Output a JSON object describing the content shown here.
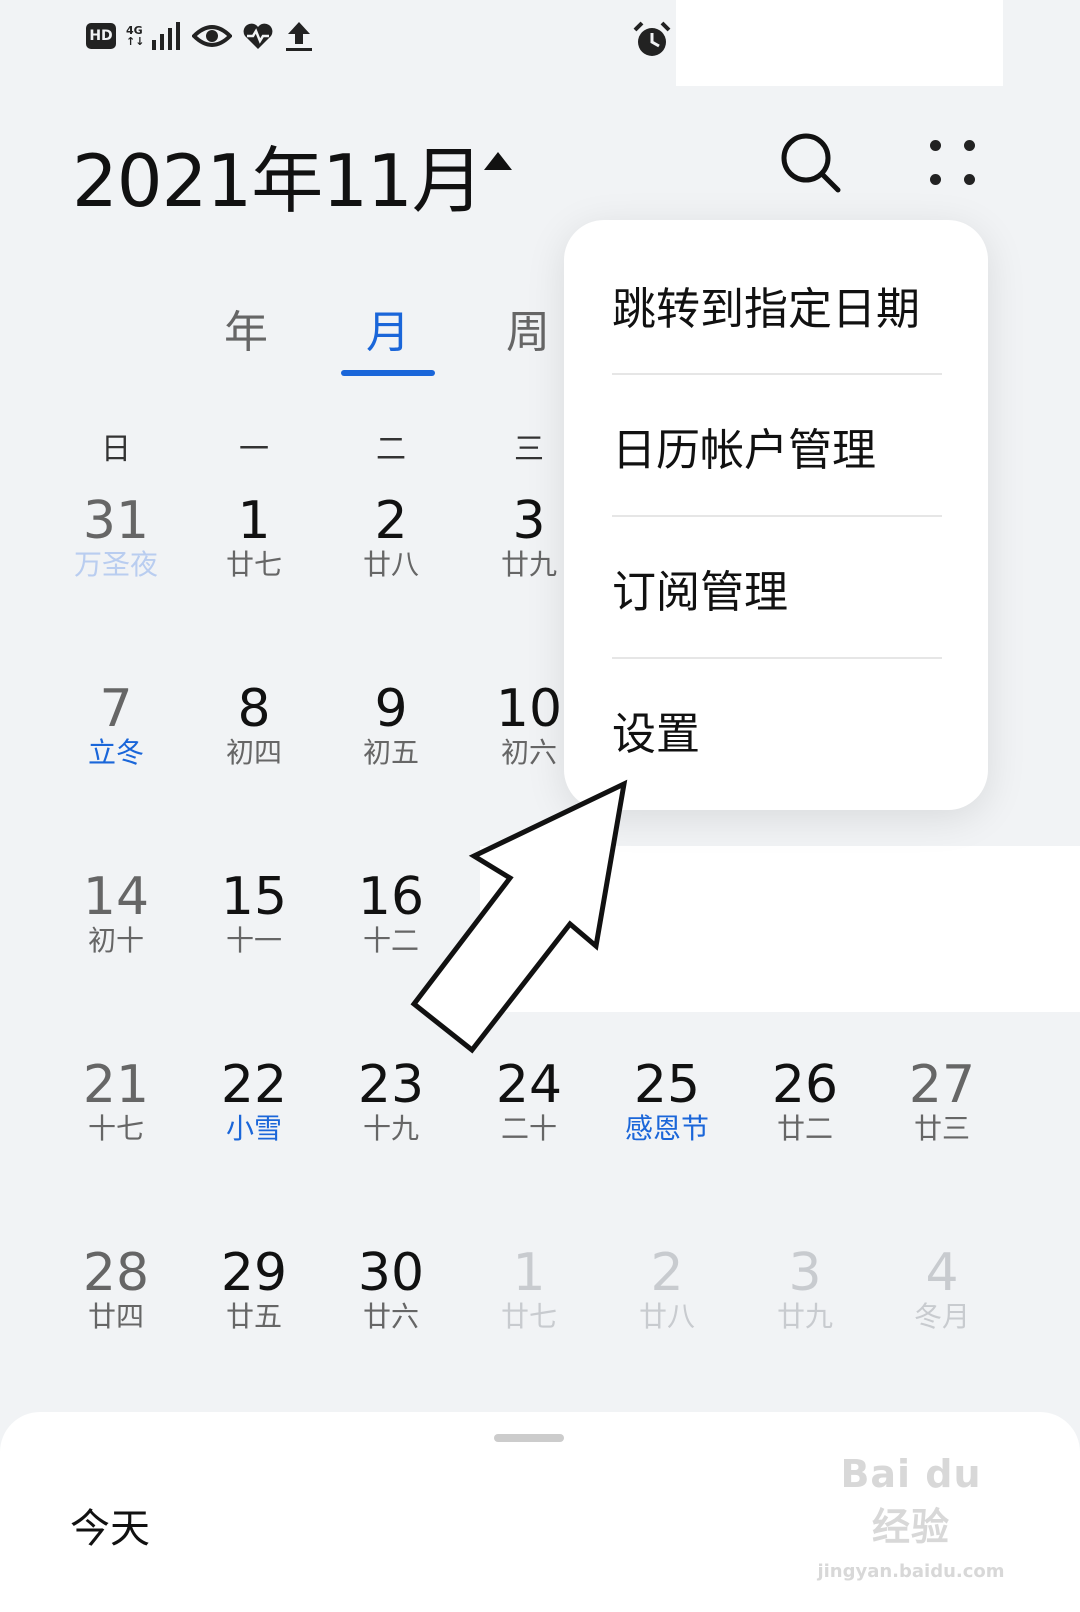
{
  "status_bar": {
    "hd_label": "HD",
    "network_label_top": "4G",
    "network_label_bottom": "↑↓"
  },
  "header": {
    "title": "2021年11月"
  },
  "view_tabs": [
    {
      "label": "年",
      "active": false
    },
    {
      "label": "月",
      "active": true
    },
    {
      "label": "周",
      "active": false
    }
  ],
  "weekdays": [
    "日",
    "一",
    "二",
    "三"
  ],
  "calendar_rows": [
    [
      {
        "day": "31",
        "sub": "万圣夜",
        "dim": true,
        "holiday": true,
        "weekend": true
      },
      {
        "day": "1",
        "sub": "廿七"
      },
      {
        "day": "2",
        "sub": "廿八"
      },
      {
        "day": "3",
        "sub": "廿九"
      }
    ],
    [
      {
        "day": "7",
        "sub": "立冬",
        "holiday": true,
        "weekend": true
      },
      {
        "day": "8",
        "sub": "初四"
      },
      {
        "day": "9",
        "sub": "初五"
      },
      {
        "day": "10",
        "sub": "初六"
      }
    ],
    [
      {
        "day": "14",
        "sub": "初十",
        "weekend": true
      },
      {
        "day": "15",
        "sub": "十一"
      },
      {
        "day": "16",
        "sub": "十二"
      }
    ],
    [
      {
        "day": "21",
        "sub": "十七",
        "weekend": true
      },
      {
        "day": "22",
        "sub": "小雪",
        "holiday": true
      },
      {
        "day": "23",
        "sub": "十九"
      },
      {
        "day": "24",
        "sub": "二十"
      },
      {
        "day": "25",
        "sub": "感恩节",
        "holiday": true
      },
      {
        "day": "26",
        "sub": "廿二"
      },
      {
        "day": "27",
        "sub": "廿三",
        "weekend": true
      }
    ],
    [
      {
        "day": "28",
        "sub": "廿四",
        "weekend": true
      },
      {
        "day": "29",
        "sub": "廿五"
      },
      {
        "day": "30",
        "sub": "廿六"
      },
      {
        "day": "1",
        "sub": "廿七",
        "dim": true
      },
      {
        "day": "2",
        "sub": "廿八",
        "dim": true
      },
      {
        "day": "3",
        "sub": "廿九",
        "dim": true
      },
      {
        "day": "4",
        "sub": "冬月",
        "dim": true
      }
    ]
  ],
  "menu": {
    "items": [
      "跳转到指定日期",
      "日历帐户管理",
      "订阅管理",
      "设置"
    ]
  },
  "bottom_sheet": {
    "today_label": "今天"
  },
  "watermark": {
    "main": "Bai du 经验",
    "sub": "jingyan.baidu.com"
  },
  "colors": {
    "accent": "#1a66d9",
    "background": "#f1f3f5"
  }
}
